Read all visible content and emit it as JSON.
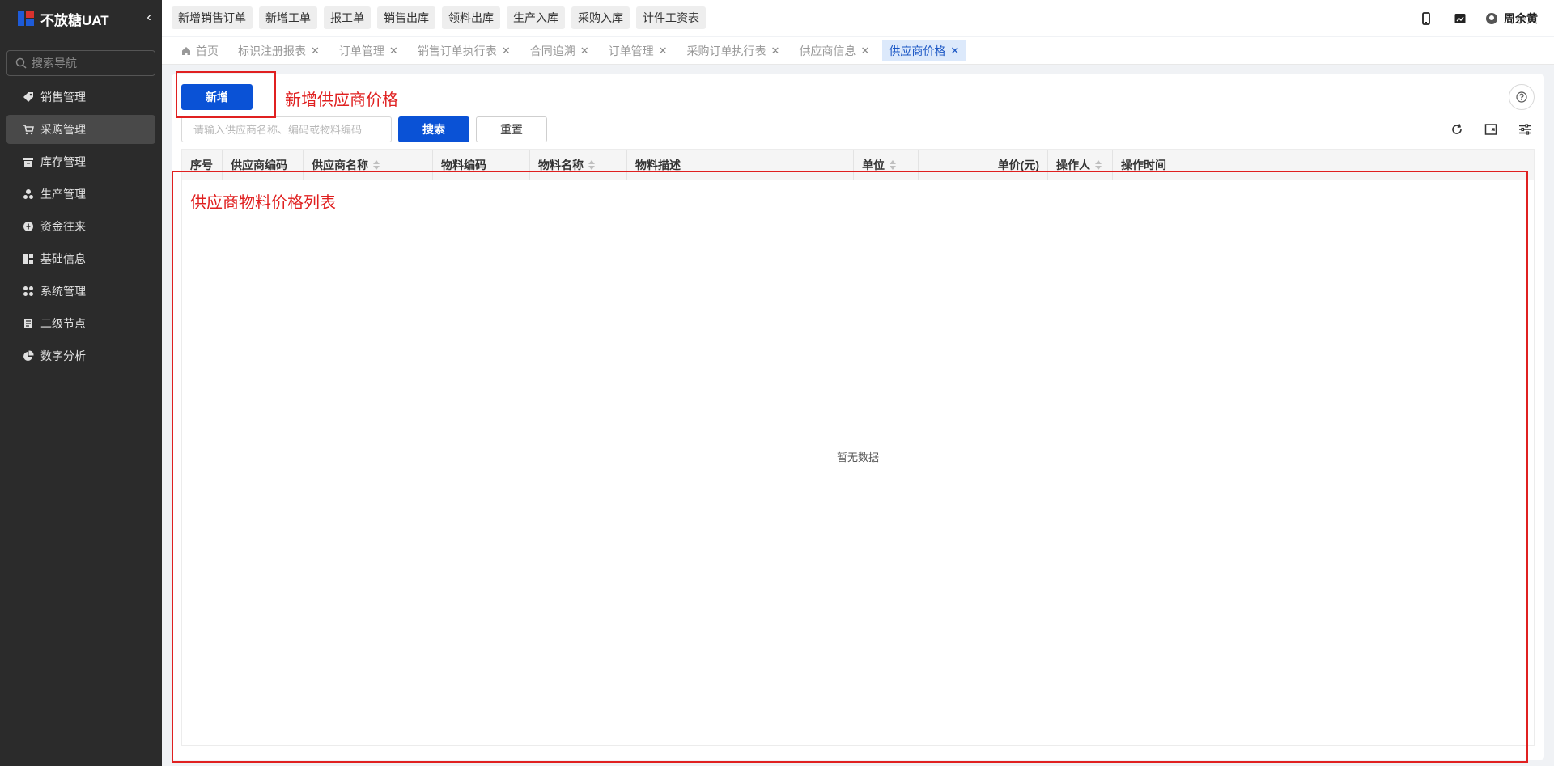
{
  "app": {
    "title": "不放糖UAT",
    "collapse_icon": "chevron-left-icon"
  },
  "sidebar": {
    "search_placeholder": "搜索导航",
    "items": [
      {
        "label": "销售管理",
        "icon": "tag-icon"
      },
      {
        "label": "采购管理",
        "icon": "cart-icon",
        "active": true
      },
      {
        "label": "库存管理",
        "icon": "warehouse-icon"
      },
      {
        "label": "生产管理",
        "icon": "production-icon"
      },
      {
        "label": "资金往来",
        "icon": "money-icon"
      },
      {
        "label": "基础信息",
        "icon": "grid-icon"
      },
      {
        "label": "系统管理",
        "icon": "apps-icon"
      },
      {
        "label": "二级节点",
        "icon": "document-icon"
      },
      {
        "label": "数字分析",
        "icon": "pie-chart-icon"
      }
    ]
  },
  "topbar": {
    "quick_actions": [
      "新增销售订单",
      "新增工单",
      "报工单",
      "销售出库",
      "领料出库",
      "生产入库",
      "采购入库",
      "计件工资表"
    ],
    "user_name": "周余黄"
  },
  "tabs": [
    {
      "label": "首页",
      "closable": false
    },
    {
      "label": "标识注册报表",
      "closable": true
    },
    {
      "label": "订单管理",
      "closable": true
    },
    {
      "label": "销售订单执行表",
      "closable": true
    },
    {
      "label": "合同追溯",
      "closable": true
    },
    {
      "label": "订单管理",
      "closable": true
    },
    {
      "label": "采购订单执行表",
      "closable": true
    },
    {
      "label": "供应商信息",
      "closable": true
    },
    {
      "label": "供应商价格",
      "closable": true,
      "active": true
    }
  ],
  "main": {
    "add_button": "新增",
    "search_placeholder": "请输入供应商名称、编码或物料编码",
    "search_button": "搜索",
    "reset_button": "重置",
    "help_icon": "question-circle-icon",
    "columns": [
      {
        "label": "序号",
        "sortable": false
      },
      {
        "label": "供应商编码",
        "sortable": false
      },
      {
        "label": "供应商名称",
        "sortable": true
      },
      {
        "label": "物料编码",
        "sortable": false
      },
      {
        "label": "物料名称",
        "sortable": true
      },
      {
        "label": "物料描述",
        "sortable": false
      },
      {
        "label": "单位",
        "sortable": true
      },
      {
        "label": "单价(元)",
        "sortable": false
      },
      {
        "label": "操作人",
        "sortable": true
      },
      {
        "label": "操作时间",
        "sortable": false
      }
    ],
    "empty_text": "暂无数据"
  },
  "annotations": {
    "add_label": "新增供应商价格",
    "list_label": "供应商物料价格列表",
    "color": "#e02020"
  }
}
